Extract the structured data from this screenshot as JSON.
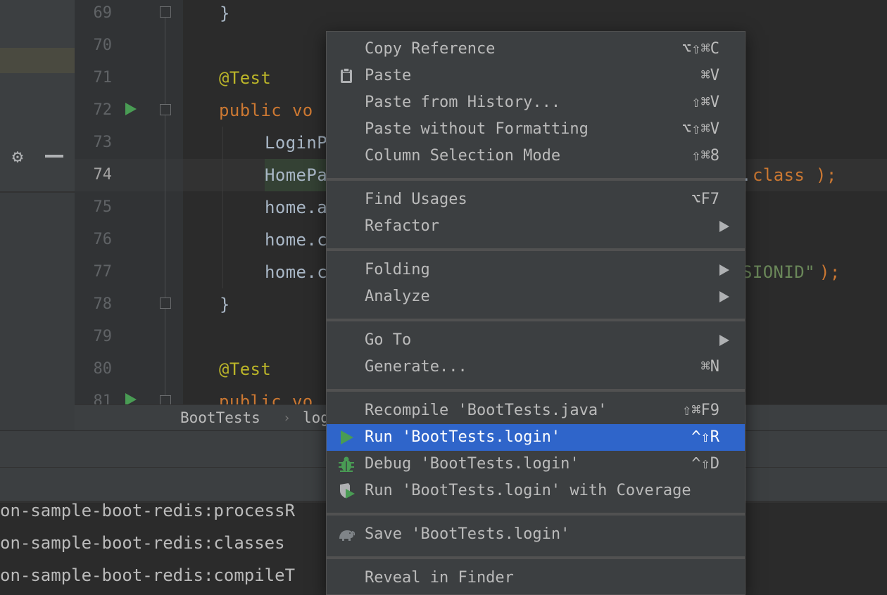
{
  "editor": {
    "lines": [
      {
        "num": "69",
        "code": "}"
      },
      {
        "num": "70",
        "code": ""
      },
      {
        "num": "71",
        "code": "@Test"
      },
      {
        "num": "72",
        "code_kw": "public vo"
      },
      {
        "num": "73",
        "code": "LoginP"
      },
      {
        "num": "74",
        "code": "HomePa",
        "code_tail_plain": "e.",
        "code_tail_kw": "class",
        "code_tail_end": ");"
      },
      {
        "num": "75",
        "code": "home.a"
      },
      {
        "num": "76",
        "code": "home.c"
      },
      {
        "num": "77",
        "code": "home.c",
        "code_tail_str": "SIONID\"",
        "code_tail_end": ");"
      },
      {
        "num": "78",
        "code": "}"
      },
      {
        "num": "79",
        "code": ""
      },
      {
        "num": "80",
        "code": "@Test"
      },
      {
        "num": "81",
        "code_kw": "public vo"
      }
    ],
    "current_line": "74"
  },
  "breadcrumb": {
    "class_name": "BootTests",
    "separator": "›",
    "method": "logi"
  },
  "console": {
    "lines": [
      "on-sample-boot-redis:processR",
      "on-sample-boot-redis:classes",
      "on-sample-boot-redis:compileT"
    ]
  },
  "left_panel": {
    "icons": [
      "gear-icon",
      "minus-icon"
    ]
  },
  "context_menu": {
    "groups": [
      [
        {
          "label": "Copy Reference",
          "shortcut": "⌥⇧⌘C"
        },
        {
          "label": "Paste",
          "shortcut": "⌘V",
          "icon": "clipboard-icon"
        },
        {
          "label": "Paste from History...",
          "shortcut": "⇧⌘V"
        },
        {
          "label": "Paste without Formatting",
          "shortcut": "⌥⇧⌘V"
        },
        {
          "label": "Column Selection Mode",
          "shortcut": "⇧⌘8"
        }
      ],
      [
        {
          "label": "Find Usages",
          "shortcut": "⌥F7"
        },
        {
          "label": "Refactor",
          "submenu": true
        }
      ],
      [
        {
          "label": "Folding",
          "submenu": true
        },
        {
          "label": "Analyze",
          "submenu": true
        }
      ],
      [
        {
          "label": "Go To",
          "submenu": true
        },
        {
          "label": "Generate...",
          "shortcut": "⌘N"
        }
      ],
      [
        {
          "label": "Recompile 'BootTests.java'",
          "shortcut": "⇧⌘F9"
        },
        {
          "label": "Run 'BootTests.login'",
          "shortcut": "^⇧R",
          "icon": "run-icon",
          "selected": true
        },
        {
          "label": "Debug 'BootTests.login'",
          "shortcut": "^⇧D",
          "icon": "debug-icon"
        },
        {
          "label": "Run 'BootTests.login' with Coverage",
          "icon": "coverage-icon"
        }
      ],
      [
        {
          "label": "Save 'BootTests.login'",
          "icon": "gradle-elephant-icon"
        }
      ],
      [
        {
          "label": "Reveal in Finder"
        }
      ]
    ]
  },
  "colors": {
    "menu_bg": "#3c3f41",
    "menu_selected": "#2f65ca",
    "run_green": "#499c54",
    "keyword": "#cc7832",
    "annotation": "#bbb529",
    "string": "#6a8759"
  }
}
